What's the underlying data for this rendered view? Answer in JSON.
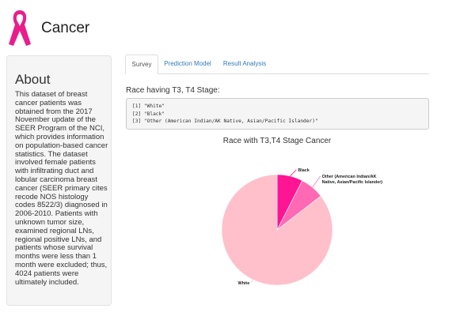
{
  "header": {
    "title": "Cancer",
    "logo_icon": "pink-ribbon-icon",
    "ribbon_color": "#e91e8c"
  },
  "sidebar": {
    "heading": "About",
    "text": "This dataset of breast cancer patients was obtained from the 2017 November update of the SEER Program of the NCI, which provides information on population-based cancer statistics. The dataset involved female patients with infiltrating duct and lobular carcinoma breast cancer (SEER primary cites recode NOS histology codes 8522/3) diagnosed in 2006-2010. Patients with unknown tumor size, examined regional LNs, regional positive LNs, and patients whose survival months were less than 1 month were excluded; thus, 4024 patients were ultimately included."
  },
  "tabs": [
    {
      "label": "Survey",
      "active": true
    },
    {
      "label": "Prediction Model",
      "active": false
    },
    {
      "label": "Result Analysis",
      "active": false
    }
  ],
  "section": {
    "label": "Race having T3, T4 Stage:",
    "output_lines": [
      "[1] \"White\"",
      "[2] \"Black\"",
      "[3] \"Other (American Indian/AK Native, Asian/Pacific Islander)\""
    ]
  },
  "chart_data": {
    "type": "pie",
    "title": "Race with T3,T4 Stage Cancer",
    "slices": [
      {
        "label": "White",
        "value": 85.5,
        "color": "#ffc0cb"
      },
      {
        "label": "Black",
        "value": 7.5,
        "color": "#ff1493"
      },
      {
        "label": "Other (American Indian/AK Native, Asian/Pacific Islander)",
        "label_lines": [
          "Other (American Indian/AK",
          "Native, Asian/Pacific Islander)"
        ],
        "value": 7.0,
        "color": "#ff69b4"
      }
    ]
  }
}
